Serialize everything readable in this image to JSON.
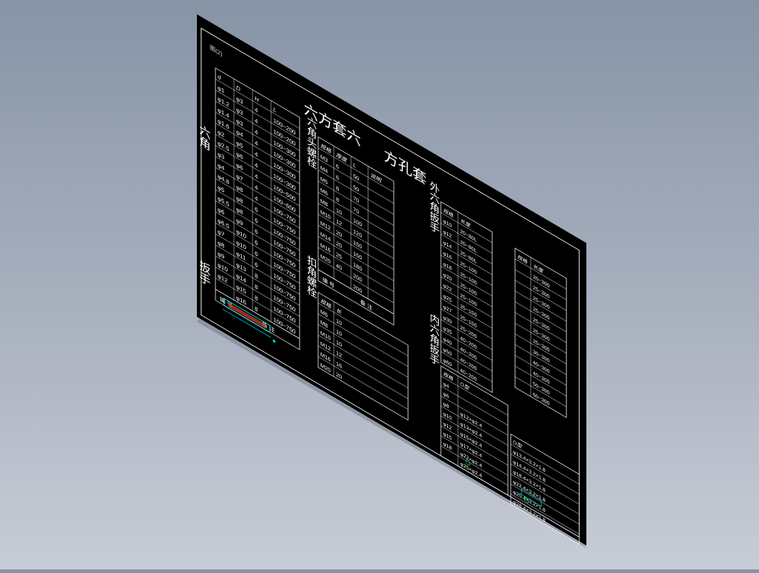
{
  "colors": {
    "background_top": "#8794a6",
    "background_bottom": "#c8ccd6",
    "sheet": "#000000",
    "line": "#ffffff",
    "accent_cyan": "#00e5e5",
    "accent_red": "#c0392b",
    "accent_green": "#00c853"
  },
  "drawing": {
    "corner_tag": "图(2)",
    "big_title_left": "六方套六",
    "big_title_right": "方孔套",
    "vertical_label_left_a": "六角",
    "vertical_label_left_b": "扳手",
    "vertical_label_mid": "六角头螺栓",
    "vertical_label_mid2": "扣角螺栓",
    "vertical_label_right": "外六角扳手",
    "vertical_label_right2": "内六角",
    "vertical_label_bottom": "内六角扳手"
  },
  "table_a": {
    "headers": [
      "d",
      "D",
      "H",
      "L"
    ],
    "rows": [
      [
        "φ1",
        "φ3",
        "4",
        "100~200"
      ],
      [
        "φ1.2",
        "φ3",
        "4",
        "100~200"
      ],
      [
        "φ1.4",
        "φ3",
        "4",
        "100~300"
      ],
      [
        "φ1.6",
        "φ4",
        "4",
        "100~300"
      ],
      [
        "φ2",
        "φ5",
        "4",
        "100~300"
      ],
      [
        "φ2.5",
        "φ6",
        "4",
        "100~300"
      ],
      [
        "φ3",
        "φ6",
        "4",
        "100~500"
      ],
      [
        "φ4",
        "φ7",
        "4",
        "100~600"
      ],
      [
        "φ4.8",
        "φ8",
        "4",
        "100~750"
      ],
      [
        "φ5",
        "φ8",
        "6",
        "100~750"
      ],
      [
        "φ5.5",
        "φ8",
        "6",
        "100~750"
      ],
      [
        "φ6",
        "φ9",
        "6",
        "100~750"
      ],
      [
        "φ6.5",
        "φ10",
        "6",
        "100~750"
      ],
      [
        "φ7",
        "φ10",
        "6",
        "100~750"
      ],
      [
        "φ8",
        "φ11",
        "6",
        "100~750"
      ],
      [
        "φ9",
        "φ13",
        "8",
        "100~750"
      ],
      [
        "φ10",
        "φ14",
        "8",
        "100~750"
      ],
      [
        "φ12",
        "φ15",
        "8",
        "100~750"
      ],
      [
        "",
        "φ16",
        "8",
        "100~750"
      ]
    ],
    "footer": [
      "编 号",
      "备 注"
    ]
  },
  "table_b": {
    "headers": [
      "规格",
      "厚度",
      "L",
      "说明"
    ],
    "rows": [
      [
        "M3",
        "6",
        "50",
        ""
      ],
      [
        "M4",
        "6",
        "50",
        ""
      ],
      [
        "M5",
        "8",
        "70",
        ""
      ],
      [
        "M6",
        "8",
        "70",
        ""
      ],
      [
        "M8",
        "10",
        "100",
        ""
      ],
      [
        "M10",
        "12",
        "120",
        ""
      ],
      [
        "M12",
        "20",
        "150",
        ""
      ],
      [
        "M14",
        "20",
        "150",
        ""
      ],
      [
        "M16",
        "25",
        "180",
        ""
      ],
      [
        "M20",
        "40",
        "200",
        ""
      ],
      [
        "",
        "",
        "200",
        ""
      ]
    ],
    "footer": [
      "编 号",
      "备 注"
    ]
  },
  "table_c": {
    "headers": [
      "规格",
      "长"
    ],
    "rows": [
      [
        "M6",
        "10"
      ],
      [
        "M8",
        "10"
      ],
      [
        "M10",
        "10"
      ],
      [
        "M12",
        "12"
      ],
      [
        "M16",
        "16"
      ],
      [
        "M20",
        "20"
      ]
    ]
  },
  "table_d": {
    "headers": [
      "规格",
      "长度"
    ],
    "rows": [
      [
        "φ10",
        "20~80L"
      ],
      [
        "φ12",
        "20~80L"
      ],
      [
        "φ14",
        "25~80L"
      ],
      [
        "φ16",
        "25~100"
      ],
      [
        "φ18",
        "25~100"
      ],
      [
        "φ20",
        "25~100"
      ],
      [
        "φ22",
        "25~100"
      ],
      [
        "φ25",
        "25~150"
      ],
      [
        "φ27",
        "25~150"
      ],
      [
        "φ30",
        "25~200"
      ],
      [
        "φ35",
        "40~200"
      ],
      [
        "φ40",
        "40~200"
      ],
      [
        "φ50",
        "40~200"
      ],
      [
        "φ60",
        "40~200"
      ]
    ]
  },
  "table_e": {
    "headers": [
      "规格",
      "长度"
    ],
    "rows": [
      [
        "",
        "20~300"
      ],
      [
        "",
        "25~300"
      ],
      [
        "",
        "25~300"
      ],
      [
        "",
        "25~300"
      ],
      [
        "",
        "25~300"
      ],
      [
        "",
        "25~300"
      ],
      [
        "",
        "25~300"
      ],
      [
        "",
        "30~300"
      ],
      [
        "",
        "40~300"
      ],
      [
        "",
        "40~300"
      ],
      [
        "",
        "50~300"
      ],
      [
        "",
        "60~300"
      ]
    ]
  },
  "table_f": {
    "headers": [
      "规格",
      "O型"
    ],
    "rows": [
      [
        "φ4",
        ""
      ],
      [
        "φ6",
        ""
      ],
      [
        "φ8",
        "φ12×φ2.4"
      ],
      [
        "φ10",
        "φ13×φ2.4"
      ],
      [
        "φ12",
        "φ15×φ2.4"
      ],
      [
        "φ15",
        "φ17×φ2.4"
      ],
      [
        "φ18",
        "φ22×φ2.4"
      ],
      [
        "",
        "φ25×φ2.4"
      ]
    ]
  },
  "table_g": {
    "headers": [
      "O型"
    ],
    "rows": [
      [
        "φ13.4×3.2×1.8"
      ],
      [
        "φ14.4×3.2×1.8"
      ],
      [
        "φ18.4×3.2×1.8"
      ],
      [
        "φ22.4×3.2×1.8"
      ],
      [
        "φ25.4×3.2×1.8"
      ],
      [
        "φ28.4×3.2×1.8"
      ]
    ]
  }
}
